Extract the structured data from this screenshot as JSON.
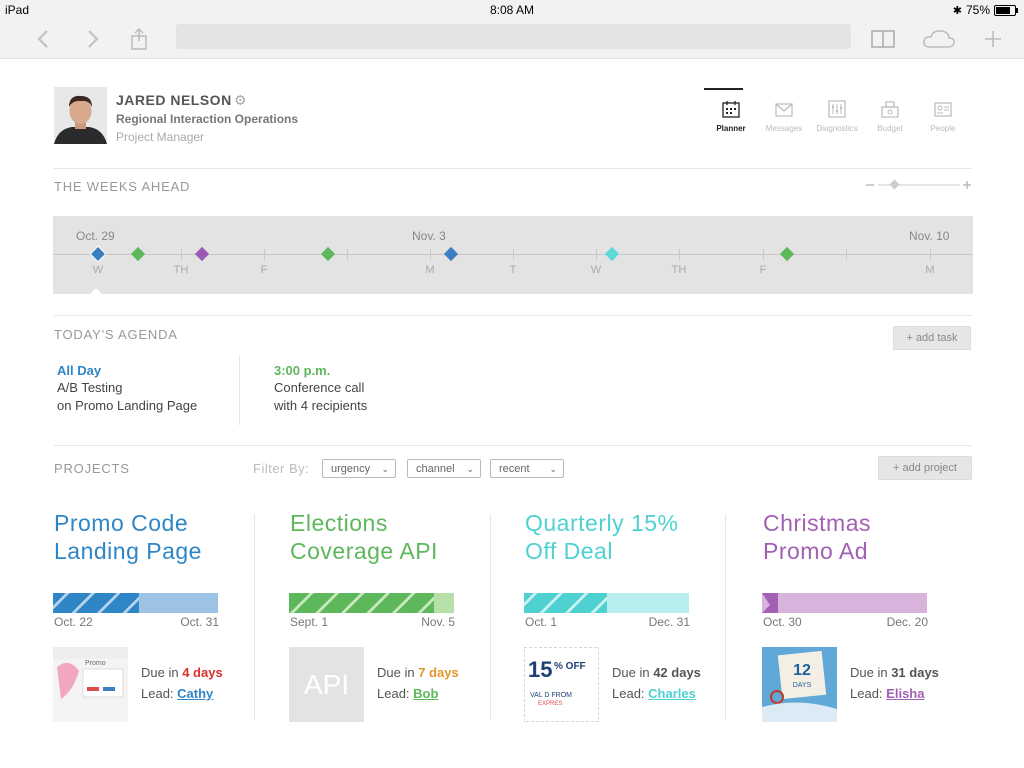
{
  "status_bar": {
    "device": "iPad",
    "time": "8:08 AM",
    "battery": "75%",
    "battery_level": 0.75
  },
  "profile": {
    "name": "JARED NELSON",
    "department": "Regional Interaction Operations",
    "role": "Project Manager"
  },
  "nav": [
    {
      "label": "Planner",
      "icon": "calendar-icon",
      "active": true
    },
    {
      "label": "Messages",
      "icon": "envelope-icon",
      "active": false
    },
    {
      "label": "Diagnostics",
      "icon": "sliders-icon",
      "active": false
    },
    {
      "label": "Budget",
      "icon": "cash-register-icon",
      "active": false
    },
    {
      "label": "People",
      "icon": "id-card-icon",
      "active": false
    }
  ],
  "weeks": {
    "title": "THE WEEKS AHEAD",
    "dates": [
      "Oct. 29",
      "Nov. 3",
      "Nov. 10"
    ],
    "days": [
      "W",
      "TH",
      "F",
      "M",
      "T",
      "W",
      "TH",
      "F",
      "M"
    ],
    "colors": {
      "blue": "#3c7fc0",
      "green": "#5db85c",
      "purple": "#9b59b6",
      "cyan": "#5fd8d8"
    }
  },
  "agenda": {
    "title": "TODAY'S AGENDA",
    "add_label": "+ add task",
    "items": [
      {
        "time": "All Day",
        "line1": "A/B Testing",
        "line2": "on Promo Landing Page",
        "color": "#2f86c7"
      },
      {
        "time": "3:00 p.m.",
        "line1": "Conference call",
        "line2": "with 4 recipients",
        "color": "#5db85c"
      }
    ]
  },
  "projects": {
    "title": "PROJECTS",
    "filter_label": "Filter By:",
    "filters": [
      "urgency",
      "channel",
      "recent"
    ],
    "add_label": "+ add project",
    "items": [
      {
        "title1": "Promo Code",
        "title2": "Landing Page",
        "start": "Oct. 22",
        "end": "Oct. 31",
        "due_prefix": "Due in",
        "due": "4 days",
        "lead_prefix": "Lead:",
        "lead": "Cathy",
        "color": "#2f86c7",
        "light": "#9cc3e6",
        "due_color": "#d9302c",
        "progress": 0.52,
        "thumb_text": "Promo"
      },
      {
        "title1": "Elections",
        "title2": "Coverage API",
        "start": "Sept. 1",
        "end": "Nov. 5",
        "due_prefix": "Due in",
        "due": "7 days",
        "lead_prefix": "Lead:",
        "lead": "Bob",
        "color": "#5db85c",
        "light": "#b7e0a8",
        "due_color": "#e6952a",
        "progress": 0.88,
        "thumb_text": "API"
      },
      {
        "title1": "Quarterly 15%",
        "title2": "Off Deal",
        "start": "Oct. 1",
        "end": "Dec. 31",
        "due_prefix": "Due in",
        "due": "42 days",
        "lead_prefix": "Lead:",
        "lead": "Charles",
        "color": "#4fd1d1",
        "light": "#b8eeee",
        "due_color": "#555555",
        "progress": 0.5,
        "thumb_text": "15% OFF"
      },
      {
        "title1": "Christmas",
        "title2": "Promo Ad",
        "start": "Oct. 30",
        "end": "Dec. 20",
        "due_prefix": "Due in",
        "due": "31 days",
        "lead_prefix": "Lead:",
        "lead": "Elisha",
        "color": "#a25fb3",
        "light": "#d8b4dd",
        "due_color": "#555555",
        "progress": 0.08,
        "thumb_text": "12 DAYS"
      }
    ]
  }
}
